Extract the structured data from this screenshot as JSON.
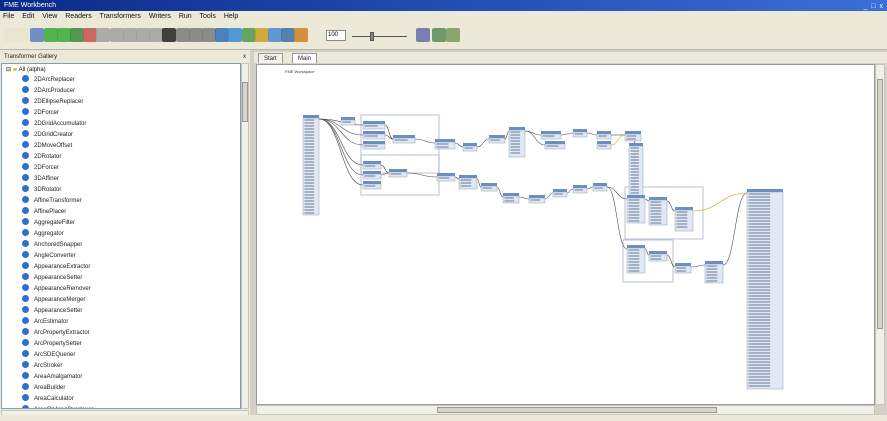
{
  "titlebar": {
    "text": "FME Workbench",
    "controls": "_ □ x"
  },
  "menubar": {
    "items": [
      "File",
      "Edit",
      "View",
      "Readers",
      "Transformers",
      "Writers",
      "Run",
      "Tools",
      "Help"
    ]
  },
  "toolbar": {
    "zoom_value": "100"
  },
  "left_panel": {
    "header": "Transformer Gallery",
    "close": "x",
    "root_label": "All (alpha)",
    "items": [
      "2DArcReplacer",
      "2DArcProducer",
      "2DEllipseReplacer",
      "2DForcer",
      "2DGridAccumulator",
      "2DGridCreator",
      "2DMoveOffset",
      "2DRotator",
      "2DForcer",
      "3DAffiner",
      "3DRotator",
      "AffineTransformer",
      "AffinePlacer",
      "AggregateFilter",
      "Aggregator",
      "AnchoredSnapper",
      "AngleConverter",
      "AppearanceExtractor",
      "AppearanceSetter",
      "AppearanceRemover",
      "AppearanceMerger",
      "AppearanceSetter",
      "ArcEstimator",
      "ArcPropertyExtractor",
      "ArcPropertySetter",
      "ArcSDEQuerier",
      "ArcStroker",
      "AreaAmalgamator",
      "AreaBuilder",
      "AreaCalculator",
      "AreaOnAreaOverlayer"
    ]
  },
  "tabs": [
    {
      "label": "Start"
    },
    {
      "label": "Main"
    }
  ],
  "canvas": {
    "bookmark_label": "FME Workspace"
  },
  "colors": {
    "titlebar": "#0a2a8a",
    "node_header": "#6a8fc0",
    "node_fill": "#dfe8f4",
    "connector": "#4a4a4a",
    "selected_link": "#d4a020"
  },
  "icons": {
    "toolbar": [
      "new-icon",
      "open-icon",
      "save-icon",
      "run-icon",
      "pause-icon",
      "stop-icon",
      "cut-icon",
      "copy-icon",
      "paste-icon",
      "undo-icon",
      "redo-icon",
      "pointer-icon",
      "pan-icon",
      "zoom-in-icon",
      "zoom-out-icon",
      "layout-icon",
      "group-icon",
      "reader-icon",
      "writer-icon",
      "transformer-icon",
      "bookmark-icon",
      "inspector-icon",
      "grid-icon",
      "log-icon",
      "parameter-icon",
      "help-icon"
    ]
  }
}
